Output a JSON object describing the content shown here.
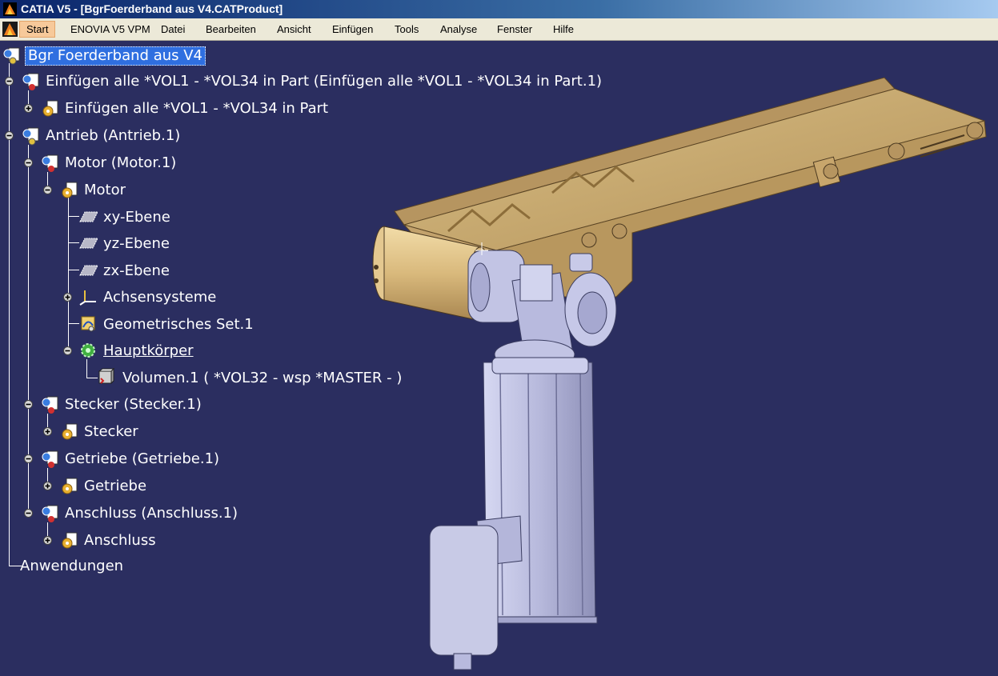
{
  "window": {
    "title": "CATIA V5 - [BgrFoerderband aus V4.CATProduct]"
  },
  "menu": {
    "items": [
      {
        "label": "Start",
        "active": true
      },
      {
        "label": "ENOVIA V5 VPM"
      },
      {
        "label": "Datei"
      },
      {
        "label": "Bearbeiten"
      },
      {
        "label": "Ansicht"
      },
      {
        "label": "Einfügen"
      },
      {
        "label": "Tools"
      },
      {
        "label": "Analyse"
      },
      {
        "label": "Fenster"
      },
      {
        "label": "Hilfe"
      }
    ]
  },
  "tree": {
    "root": "Bgr Foerderband aus V4",
    "nodes": [
      {
        "label": "Einfügen alle *VOL1 - *VOL34 in Part (Einfügen alle *VOL1 - *VOL34 in Part.1)",
        "icon": "product-icon",
        "toggle": "minus"
      },
      {
        "label": "Einfügen alle *VOL1 - *VOL34 in Part",
        "icon": "part-icon",
        "toggle": "plus"
      },
      {
        "label": "Antrieb (Antrieb.1)",
        "icon": "product-icon",
        "toggle": "minus"
      },
      {
        "label": "Motor (Motor.1)",
        "icon": "product-icon",
        "toggle": "minus"
      },
      {
        "label": "Motor",
        "icon": "part-icon",
        "toggle": "minus"
      },
      {
        "label": "xy-Ebene",
        "icon": "plane-icon"
      },
      {
        "label": "yz-Ebene",
        "icon": "plane-icon"
      },
      {
        "label": "zx-Ebene",
        "icon": "plane-icon"
      },
      {
        "label": "Achsensysteme",
        "icon": "axis-system-icon",
        "toggle": "plus"
      },
      {
        "label": "Geometrisches Set.1",
        "icon": "geometrical-set-icon"
      },
      {
        "label": "Hauptkörper",
        "icon": "body-icon",
        "toggle": "minus"
      },
      {
        "label": "Volumen.1 ( *VOL32 - wsp *MASTER -  )",
        "icon": "volume-icon"
      },
      {
        "label": "Stecker (Stecker.1)",
        "icon": "product-icon",
        "toggle": "minus"
      },
      {
        "label": "Stecker",
        "icon": "part-icon",
        "toggle": "plus"
      },
      {
        "label": "Getriebe (Getriebe.1)",
        "icon": "product-icon",
        "toggle": "minus"
      },
      {
        "label": "Getriebe",
        "icon": "part-icon",
        "toggle": "plus"
      },
      {
        "label": "Anschluss (Anschluss.1)",
        "icon": "product-icon",
        "toggle": "minus"
      },
      {
        "label": "Anschluss",
        "icon": "part-icon",
        "toggle": "plus"
      },
      {
        "label": "Anwendungen"
      }
    ]
  },
  "colors": {
    "background": "#2b2e60",
    "selection": "#2f6fe0",
    "conveyor": "#c9a86a",
    "motor": "#b9bce0"
  }
}
